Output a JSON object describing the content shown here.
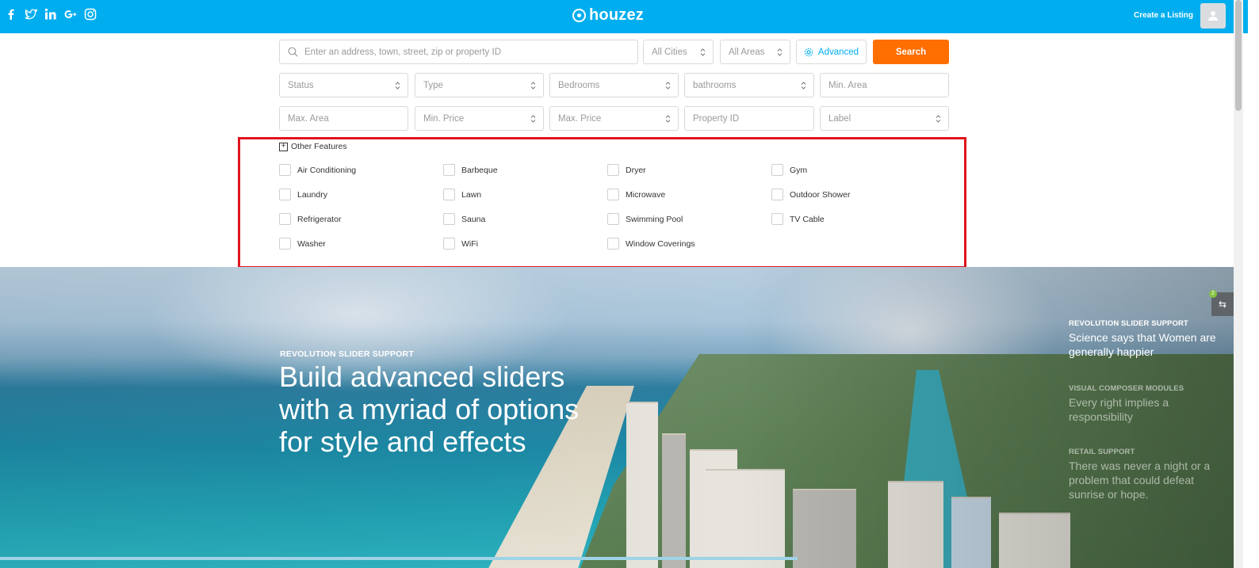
{
  "header": {
    "logo_text": "houzez",
    "create_listing": "Create a Listing",
    "social_icons": [
      "facebook-icon",
      "twitter-icon",
      "linkedin-icon",
      "google-plus-icon",
      "instagram-icon"
    ],
    "bg_color": "#00aeef"
  },
  "search": {
    "placeholder": "Enter an address, town, street, zip or property ID",
    "cities": "All Cities",
    "areas": "All Areas",
    "advanced_label": "Advanced",
    "search_label": "Search",
    "search_color": "#ff6e00",
    "row2": [
      "Status",
      "Type",
      "Bedrooms",
      "bathrooms",
      "Min. Area"
    ],
    "row3": [
      "Max. Area",
      "Min. Price",
      "Max. Price",
      "Property ID",
      "Label"
    ]
  },
  "features": {
    "toggle_label": "Other Features",
    "items": [
      "Air Conditioning",
      "Barbeque",
      "Dryer",
      "Gym",
      "Laundry",
      "Lawn",
      "Microwave",
      "Outdoor Shower",
      "Refrigerator",
      "Sauna",
      "Swimming Pool",
      "TV Cable",
      "Washer",
      "WiFi",
      "Window Coverings"
    ],
    "highlight_color": "#e0141e"
  },
  "hero": {
    "kicker": "REVOLUTION SLIDER SUPPORT",
    "title": "Build advanced sliders with a myriad of options for style and effects",
    "side": [
      {
        "kicker": "REVOLUTION SLIDER SUPPORT",
        "title": "Science says that Women are generally happier"
      },
      {
        "kicker": "VISUAL COMPOSER MODULES",
        "title": "Every right implies a responsibility"
      },
      {
        "kicker": "RETAIL SUPPORT",
        "title": "There was never a night or a problem that could defeat sunrise or hope."
      }
    ],
    "compare_count": "2"
  }
}
